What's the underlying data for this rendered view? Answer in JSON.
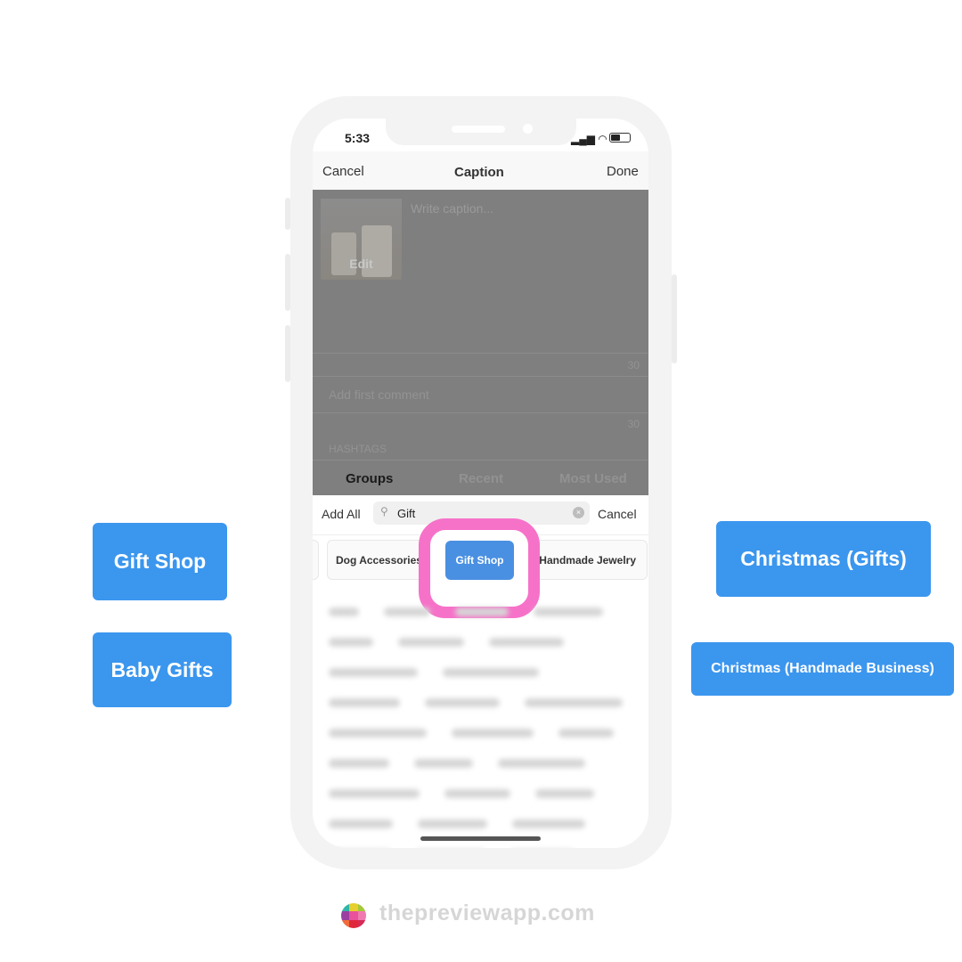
{
  "status": {
    "time": "5:33"
  },
  "nav": {
    "cancel": "Cancel",
    "title": "Caption",
    "done": "Done"
  },
  "caption": {
    "placeholder": "Write caption...",
    "edit": "Edit",
    "count1": "30",
    "comment_placeholder": "Add first comment",
    "count2": "30",
    "hashtags_label": "HASHTAGS"
  },
  "tabs": [
    "Groups",
    "Recent",
    "Most Used"
  ],
  "search": {
    "add_all": "Add All",
    "value": "Gift",
    "cancel": "Cancel"
  },
  "chips": [
    "Dog Accessories",
    "Gift Shop",
    "Handmade Jewelry"
  ],
  "side_groups": [
    "Gift Shop",
    "Baby Gifts",
    "Christmas (Gifts)",
    "Christmas (Handmade Business)"
  ],
  "footer": {
    "brand": "thepreviewapp.com"
  },
  "colors": {
    "accent": "#3b96ee",
    "highlight": "#f672c8",
    "overlay": "#7f7f7f"
  }
}
